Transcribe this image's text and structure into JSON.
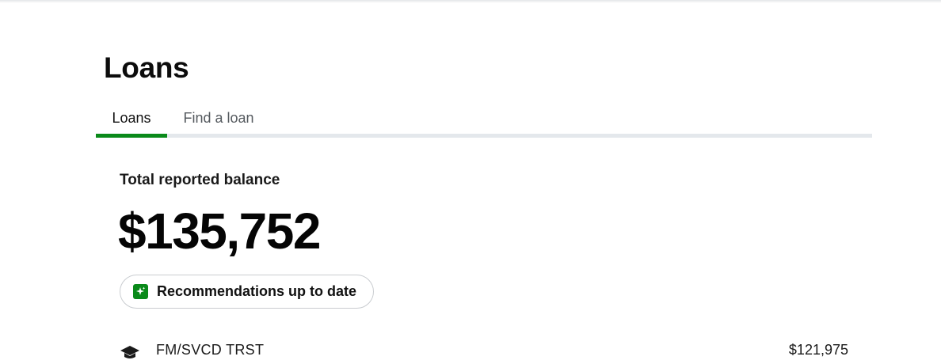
{
  "page": {
    "title": "Loans"
  },
  "tabs": [
    {
      "label": "Loans",
      "active": true
    },
    {
      "label": "Find a loan",
      "active": false
    }
  ],
  "summary": {
    "balance_label": "Total reported balance",
    "balance_amount": "$135,752"
  },
  "recommendations": {
    "label": "Recommendations up to date",
    "icon": "sparkle-icon"
  },
  "loans": [
    {
      "icon": "graduation-cap-icon",
      "name": "FM/SVCD TRST",
      "amount": "$121,975"
    }
  ],
  "colors": {
    "accent": "#0a8a1a",
    "tab_track": "#e4e8ec",
    "text": "#0c0c0c",
    "muted": "#555a5f"
  }
}
